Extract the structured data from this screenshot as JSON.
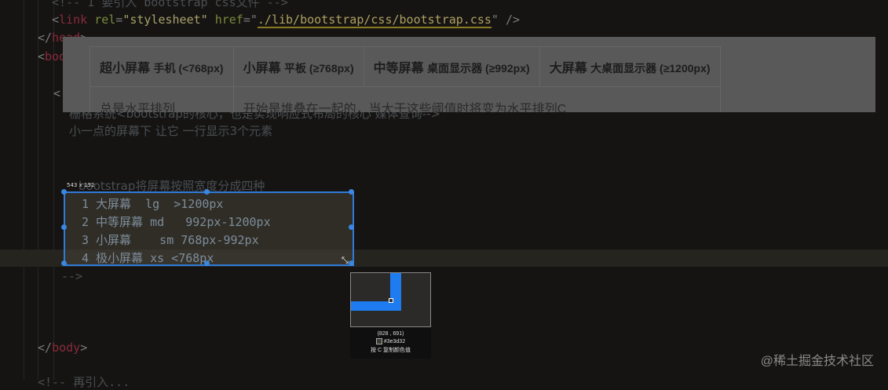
{
  "code": {
    "comment_top": "<!-- 1 要引入 bootstrap css文件 -->",
    "link_tag": "link",
    "rel_attr": "rel",
    "rel_val": "\"stylesheet\"",
    "href_attr": "href",
    "href_val": "./lib/bootstrap/css/bootstrap.css",
    "head_close": "head",
    "body_open": "body",
    "partial_open": "<",
    "note1": "栅格系统<bootstrap的核心，也是实现响应式布局的核心 媒体查询-->",
    "note2": "小一点的屏幕下 让它 一行显示3个元素",
    "note3": "bootstrap将屏幕按照宽度分成四种",
    "list": [
      "1 大屏幕  lg  >1200px",
      "2 中等屏幕 md   992px-1200px",
      "3 小屏幕    sm 768px-992px",
      "4 极小屏幕 xs <768px"
    ],
    "comment_end": "-->",
    "body_close": "body",
    "bottom_partial": "<!-- 再引入..."
  },
  "table": {
    "headers": [
      {
        "main": "超小屏幕",
        "sub": "手机 (<768px)"
      },
      {
        "main": "小屏幕",
        "sub": "平板 (≥768px)"
      },
      {
        "main": "中等屏幕",
        "sub": "桌面显示器 (≥992px)"
      },
      {
        "main": "大屏幕",
        "sub": "大桌面显示器 (≥1200px)"
      }
    ],
    "row": [
      "总是水平排列",
      "开始是堆叠在一起的，当大于这些阈值时将变为水平排列C"
    ]
  },
  "selection": {
    "size": "543 x 132"
  },
  "magnifier": {
    "coords": "(828 , 691)",
    "color": "#3e3d32",
    "hint": "按 C 复制颜色值"
  },
  "watermark": "@稀土掘金技术社区"
}
